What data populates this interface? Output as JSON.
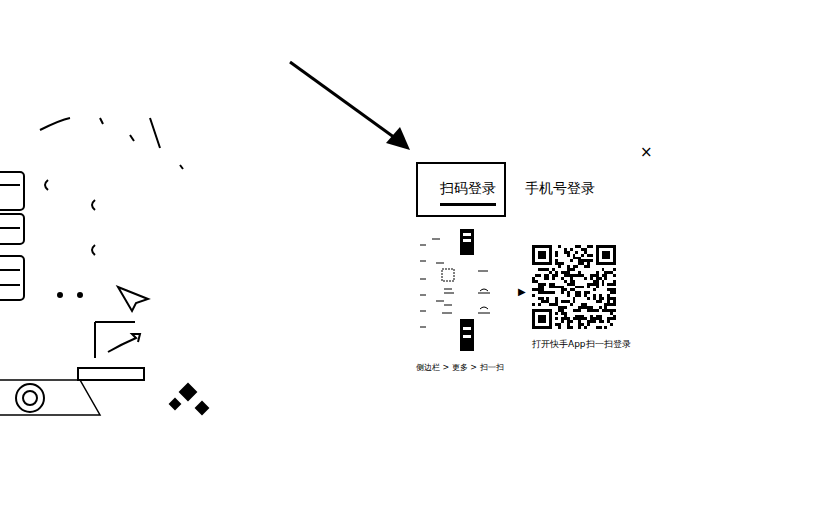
{
  "dialog": {
    "close": "×"
  },
  "tabs": [
    {
      "label": "扫码登录",
      "selected": true
    },
    {
      "label": "手机号登录",
      "selected": false
    }
  ],
  "guide": {
    "caption": "侧边栏 > 更多 > 扫一扫",
    "arrow": "▶"
  },
  "qr": {
    "caption": "打开快手App扫一扫登录"
  }
}
